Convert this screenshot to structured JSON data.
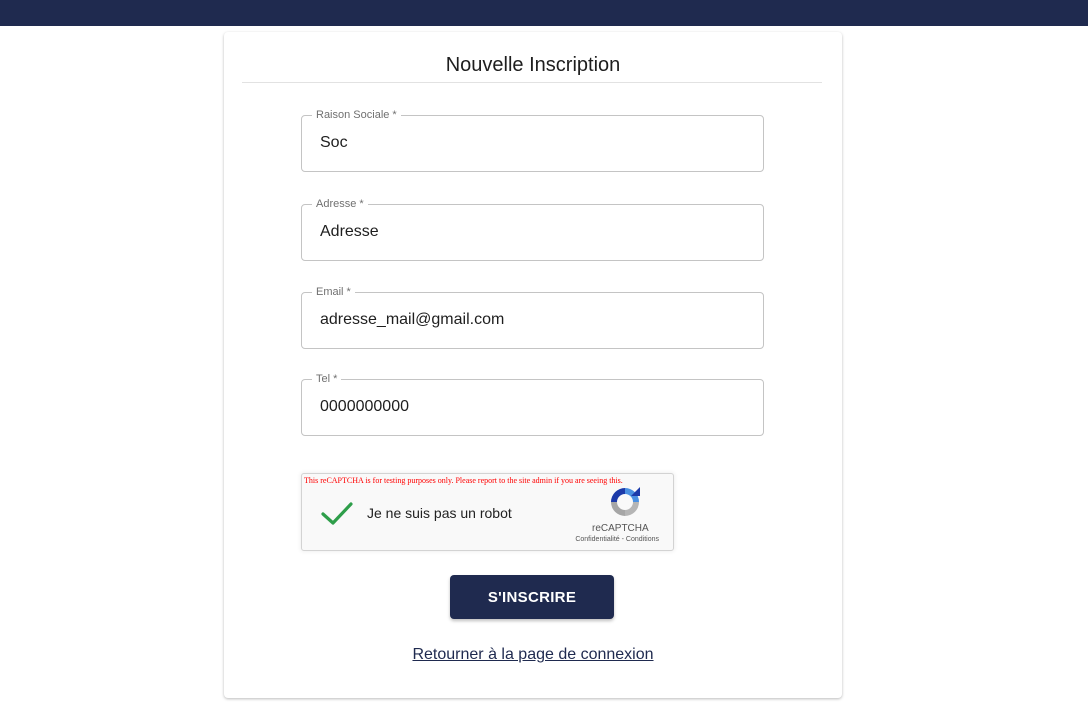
{
  "colors": {
    "header_bar": "#1f2a4f",
    "primary_button": "#1f2a4f",
    "captcha_warning": "#ff0000",
    "check_green": "#2e9e4a"
  },
  "form": {
    "title": "Nouvelle Inscription",
    "fields": [
      {
        "label": "Raison Sociale *",
        "value": "Soc"
      },
      {
        "label": "Adresse *",
        "value": "Adresse"
      },
      {
        "label": "Email *",
        "value": "adresse_mail@gmail.com"
      },
      {
        "label": "Tel *",
        "value": "0000000000"
      }
    ],
    "submit_label": "S'INSCRIRE",
    "back_link": "Retourner à la page de connexion"
  },
  "captcha": {
    "warning": "This reCAPTCHA is for testing purposes only. Please report to the site admin if you are seeing this.",
    "label": "Je ne suis pas un robot",
    "checked": true,
    "brand": "reCAPTCHA",
    "privacy": "Confidentialité",
    "separator": " - ",
    "terms": "Conditions",
    "check_icon": "checkmark-icon",
    "logo_icon": "recaptcha-logo-icon"
  }
}
